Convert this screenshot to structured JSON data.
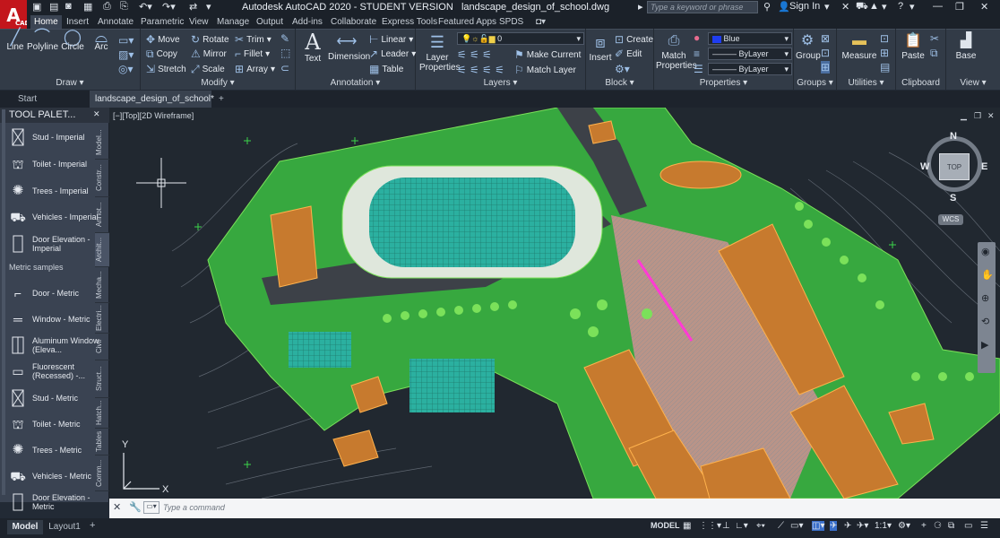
{
  "app": {
    "title": "Autodesk AutoCAD 2020 - STUDENT VERSION",
    "file": "landscape_design_of_school.dwg",
    "logo": "A",
    "logo_sub": "CAD",
    "search_placeholder": "Type a keyword or phrase",
    "sign_in": "Sign In"
  },
  "menu_tabs": [
    "Home",
    "Insert",
    "Annotate",
    "Parametric",
    "View",
    "Manage",
    "Output",
    "Add-ins",
    "Collaborate",
    "Express Tools",
    "Featured Apps",
    "SPDS"
  ],
  "ribbon": {
    "draw": {
      "label": "Draw",
      "line": "Line",
      "polyline": "Polyline",
      "circle": "Circle",
      "arc": "Arc"
    },
    "modify": {
      "label": "Modify",
      "move": "Move",
      "rotate": "Rotate",
      "trim": "Trim",
      "copy": "Copy",
      "mirror": "Mirror",
      "fillet": "Fillet",
      "stretch": "Stretch",
      "scale": "Scale",
      "array": "Array"
    },
    "annotation": {
      "label": "Annotation",
      "text": "Text",
      "dimension": "Dimension",
      "linear": "Linear",
      "leader": "Leader",
      "table": "Table"
    },
    "layers": {
      "label": "Layers",
      "layer_properties": "Layer Properties",
      "current_layer": "0",
      "make_current": "Make Current",
      "match_layer": "Match Layer"
    },
    "block": {
      "label": "Block",
      "insert": "Insert",
      "create": "Create",
      "edit": "Edit"
    },
    "properties": {
      "label": "Properties",
      "match_properties": "Match Properties",
      "color": "Blue",
      "linetype": "ByLayer",
      "lineweight": "ByLayer"
    },
    "groups": {
      "label": "Groups",
      "group": "Group"
    },
    "utilities": {
      "label": "Utilities",
      "measure": "Measure"
    },
    "clipboard": {
      "label": "Clipboard",
      "paste": "Paste"
    },
    "view": {
      "label": "View",
      "base": "Base"
    }
  },
  "doc_tabs": [
    "Start",
    "landscape_design_of_school*"
  ],
  "palette": {
    "title": "TOOL PALET...",
    "section": "Metric samples",
    "items_a": [
      "Stud - Imperial",
      "Toilet - Imperial",
      "Trees - Imperial",
      "Vehicles - Imperial",
      "Door Elevation - Imperial"
    ],
    "items_b": [
      "Door - Metric",
      "Window - Metric",
      "Aluminum Window (Eleva...",
      "Fluorescent (Recessed) -...",
      "Stud - Metric",
      "Toilet - Metric",
      "Trees - Metric",
      "Vehicles - Metric",
      "Door Elevation - Metric"
    ],
    "side_tabs": [
      "Model...",
      "Constr...",
      "Annot...",
      "Archit...",
      "Mecha...",
      "Electri...",
      "Civil",
      "Struct...",
      "Hatch...",
      "Tables",
      "Comm..."
    ]
  },
  "viewport": {
    "label": "[−][Top][2D Wireframe]",
    "cube_top": "TOP",
    "compass": {
      "n": "N",
      "s": "S",
      "e": "E",
      "w": "W"
    },
    "wcs": "WCS",
    "axis_x": "X",
    "axis_y": "Y"
  },
  "command": {
    "placeholder": "Type a command"
  },
  "layout_tabs": [
    "Model",
    "Layout1"
  ],
  "status": {
    "model": "MODEL",
    "scale": "1:1"
  },
  "colors": {
    "accent": "#3d8bd8",
    "logo_red": "#c3161c",
    "site_green": "#3cbf3c",
    "building_orange": "#c77a2e",
    "field_teal": "#2bb0a0"
  }
}
